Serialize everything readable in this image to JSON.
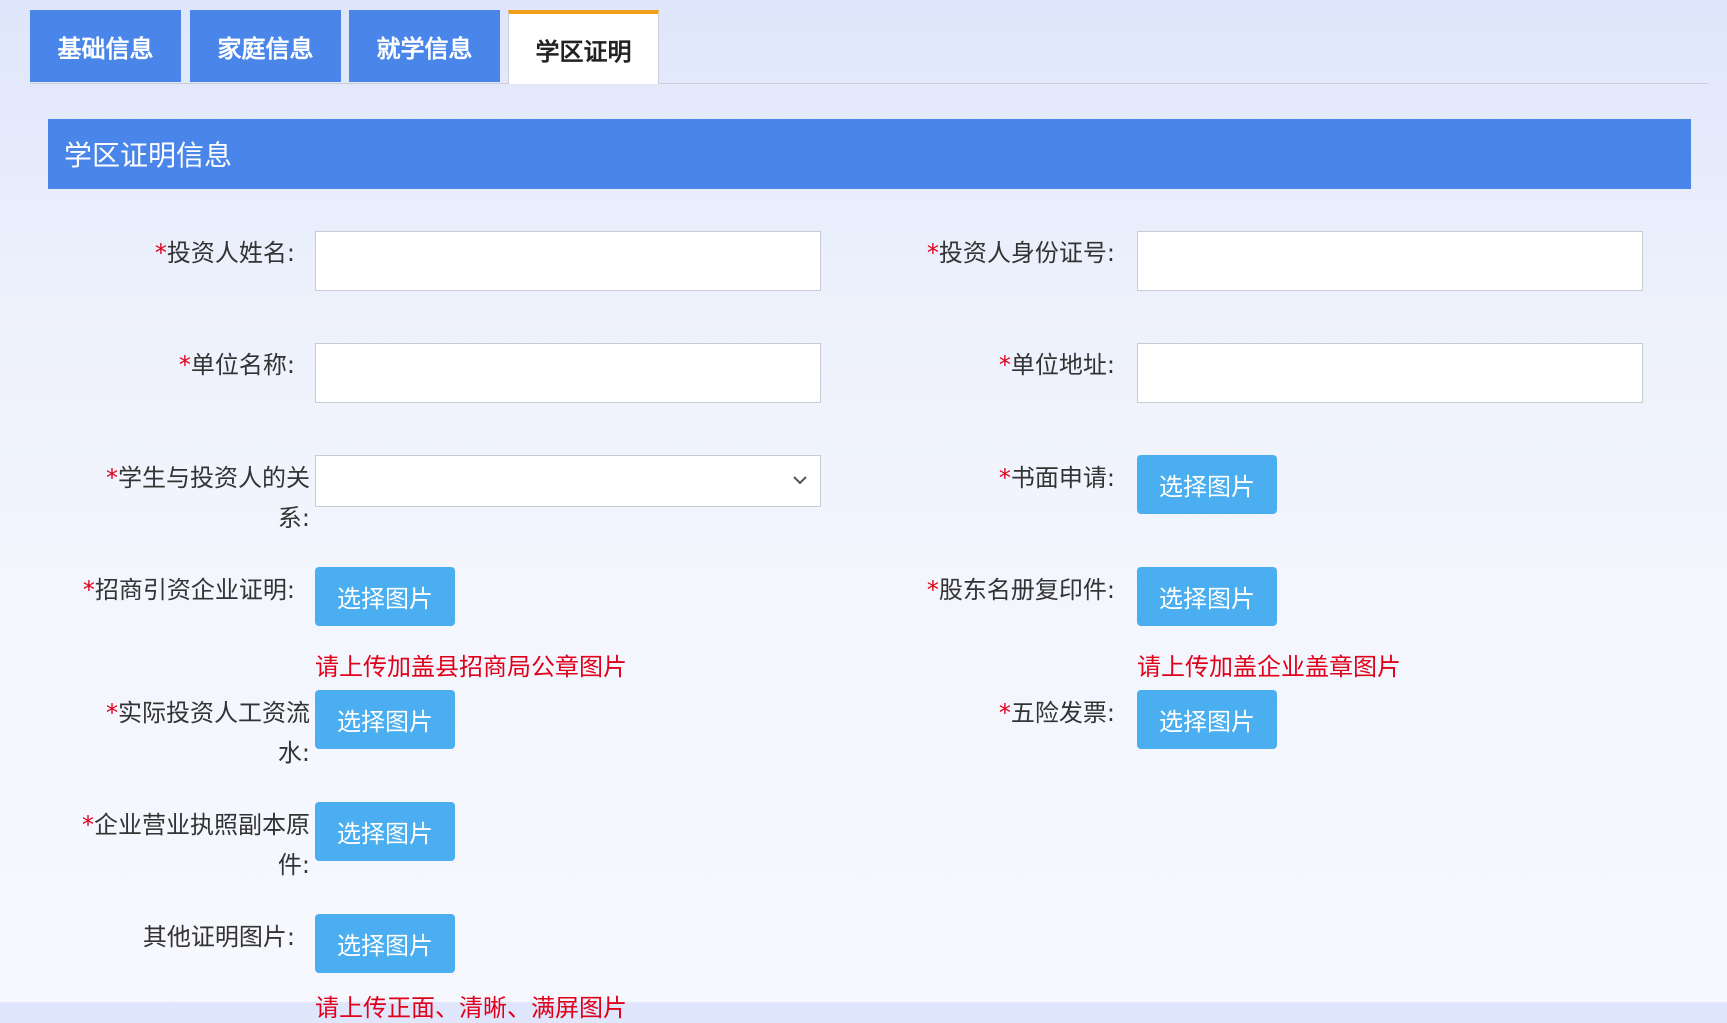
{
  "tabs": [
    "基础信息",
    "家庭信息",
    "就学信息",
    "学区证明"
  ],
  "section_title": "学区证明信息",
  "fields": {
    "investor_name": {
      "label": "投资人姓名:",
      "value": ""
    },
    "investor_id": {
      "label": "投资人身份证号:",
      "value": ""
    },
    "company_name": {
      "label": "单位名称:",
      "value": ""
    },
    "company_address": {
      "label": "单位地址:",
      "value": ""
    },
    "relation": {
      "label": "学生与投资人的关系:",
      "value": ""
    },
    "written_application": {
      "label": "书面申请:"
    },
    "investment_certificate": {
      "label": "招商引资企业证明:",
      "hint": "请上传加盖县招商局公章图片"
    },
    "shareholder_register": {
      "label": "股东名册复印件:",
      "hint": "请上传加盖企业盖章图片"
    },
    "salary_statement": {
      "label": "实际投资人工资流水:"
    },
    "insurance_invoice": {
      "label": "五险发票:"
    },
    "business_license": {
      "label": "企业营业执照副本原件:"
    },
    "other_proof": {
      "label": "其他证明图片:",
      "hint": "请上传正面、清晰、满屏图片"
    }
  },
  "required_mark": "*",
  "upload_button_label": "选择图片",
  "colors": {
    "tab_blue": "#4a86ea",
    "button_blue": "#4aaef0",
    "required_red": "#e0001b",
    "active_tab_accent": "#f2a01c"
  }
}
